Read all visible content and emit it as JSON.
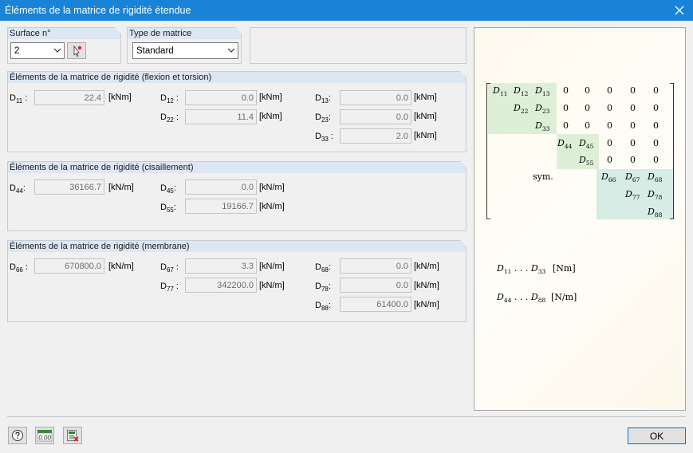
{
  "window": {
    "title": "Éléments de la matrice de rigidité étendue"
  },
  "surface": {
    "label": "Surface n°",
    "value": "2"
  },
  "matrix_type": {
    "label": "Type de matrice",
    "value": "Standard"
  },
  "bending": {
    "title": "Éléments de la matrice de rigidité (flexion et torsion)",
    "d11": {
      "value": "22.4",
      "unit": "[kNm]"
    },
    "d12": {
      "value": "0.0",
      "unit": "[kNm]"
    },
    "d13": {
      "value": "0.0",
      "unit": "[kNm]"
    },
    "d22": {
      "value": "11.4",
      "unit": "[kNm]"
    },
    "d23": {
      "value": "0.0",
      "unit": "[kNm]"
    },
    "d33": {
      "value": "2.0",
      "unit": "[kNm]"
    }
  },
  "shear": {
    "title": "Éléments de la matrice de rigidité (cisaillement)",
    "d44": {
      "value": "36166.7",
      "unit": "[kN/m]"
    },
    "d45": {
      "value": "0.0",
      "unit": "[kN/m]"
    },
    "d55": {
      "value": "19166.7",
      "unit": "[kN/m]"
    }
  },
  "membrane": {
    "title": "Éléments de la matrice de rigidité (membrane)",
    "d66": {
      "value": "670800.0",
      "unit": "[kN/m]"
    },
    "d67": {
      "value": "3.3",
      "unit": "[kN/m]"
    },
    "d68": {
      "value": "0.0",
      "unit": "[kN/m]"
    },
    "d77": {
      "value": "342200.0",
      "unit": "[kN/m]"
    },
    "d78": {
      "value": "0.0",
      "unit": "[kN/m]"
    },
    "d88": {
      "value": "61400.0",
      "unit": "[kN/m]"
    }
  },
  "preview": {
    "sym": "sym.",
    "zero": "0",
    "legend1_unit": "[Nm]",
    "legend2_unit": "[N/m]"
  },
  "footer": {
    "ok_label": "OK"
  },
  "icons": {
    "help": "help-icon",
    "decimals": "decimal-places-icon",
    "export": "export-icon",
    "pick": "pick-surface-icon",
    "close": "close-icon"
  }
}
